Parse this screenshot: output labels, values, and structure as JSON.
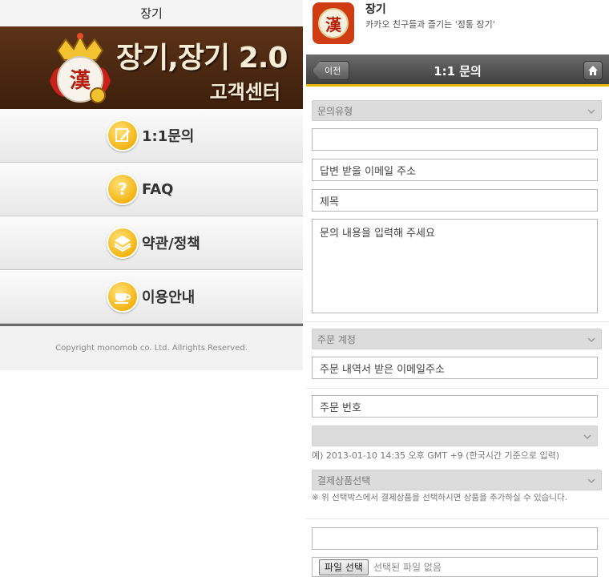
{
  "left": {
    "window_title": "장기",
    "banner": {
      "title": "장기,장기 2.0",
      "subtitle": "고객센터",
      "emblem_char": "漢"
    },
    "menu": [
      {
        "label": "1:1문의",
        "icon": "pencil-icon"
      },
      {
        "label": "FAQ",
        "icon": "question-icon"
      },
      {
        "label": "약관/정책",
        "icon": "layers-icon"
      },
      {
        "label": "이용안내",
        "icon": "cup-icon"
      }
    ],
    "footer": "Copyright monomob co. Ltd. Allrights Reserved."
  },
  "right": {
    "app": {
      "name": "장기",
      "description": "카카오 친구들과 즐기는 '정통 장기'",
      "icon_char": "漢"
    },
    "navbar": {
      "back_label": "이전",
      "title": "1:1 문의"
    },
    "form": {
      "inquiry_type_select": "문의유형",
      "blank_field_1": "",
      "email_placeholder": "답변 받을 이메일 주소",
      "subject_placeholder": "제목",
      "content_placeholder": "문의 내용을 입력해 주세요",
      "order_account_select": "주문 계정",
      "order_email_placeholder": "주문 내역서 받은 이메일주소",
      "order_number_placeholder": "주문 번호",
      "date_select": "",
      "date_note": "예) 2013-01-10 14:35 오후 GMT +9 (한국시간 기준으로 입력)",
      "product_select": "결제상품선택",
      "product_note": "※ 위 선택박스에서 결제상품을 선택하시면 상품을 추가하실 수 있습니다.",
      "blank_field_2": "",
      "file_button": "파일 선택",
      "file_status": "선택된 파일 없음"
    }
  }
}
